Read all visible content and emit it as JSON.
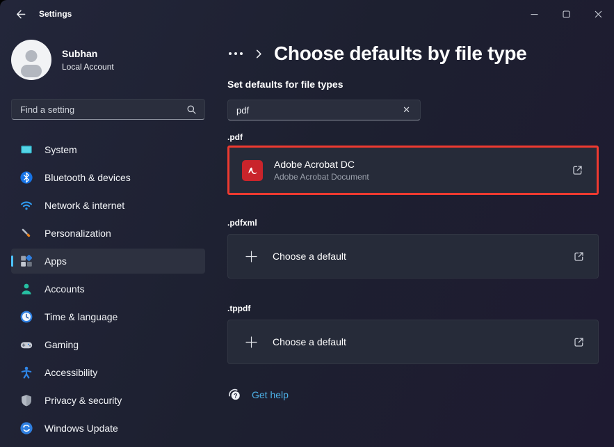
{
  "window": {
    "title": "Settings",
    "controls": {
      "minimize": "minimize",
      "maximize": "maximize",
      "close": "close"
    }
  },
  "sidebar": {
    "user": {
      "name": "Subhan",
      "type": "Local Account"
    },
    "search_placeholder": "Find a setting",
    "items": [
      {
        "label": "System",
        "icon": "system-icon"
      },
      {
        "label": "Bluetooth & devices",
        "icon": "bluetooth-icon"
      },
      {
        "label": "Network & internet",
        "icon": "wifi-icon"
      },
      {
        "label": "Personalization",
        "icon": "brush-icon"
      },
      {
        "label": "Apps",
        "icon": "apps-icon",
        "selected": true
      },
      {
        "label": "Accounts",
        "icon": "person-icon"
      },
      {
        "label": "Time & language",
        "icon": "clock-icon"
      },
      {
        "label": "Gaming",
        "icon": "gamepad-icon"
      },
      {
        "label": "Accessibility",
        "icon": "accessibility-icon"
      },
      {
        "label": "Privacy & security",
        "icon": "shield-icon"
      },
      {
        "label": "Windows Update",
        "icon": "update-icon"
      }
    ]
  },
  "main": {
    "breadcrumb": {
      "ellipsis": "more-breadcrumb",
      "title": "Choose defaults by file type"
    },
    "section_label": "Set defaults for file types",
    "search": {
      "value": "pdf",
      "clear_icon": "✕"
    },
    "file_types": [
      {
        "ext": ".pdf",
        "app_name": "Adobe Acrobat DC",
        "app_desc": "Adobe Acrobat Document",
        "highlighted": true
      },
      {
        "ext": ".pdfxml",
        "action": "Choose a default"
      },
      {
        "ext": ".tppdf",
        "action": "Choose a default"
      }
    ],
    "get_help_label": "Get help"
  },
  "colors": {
    "accent": "#4cc2ff",
    "annotation_border": "#ee3a30",
    "link": "#4db2e8",
    "adobe_red": "#c9242b",
    "card_bg": "#262b39"
  }
}
